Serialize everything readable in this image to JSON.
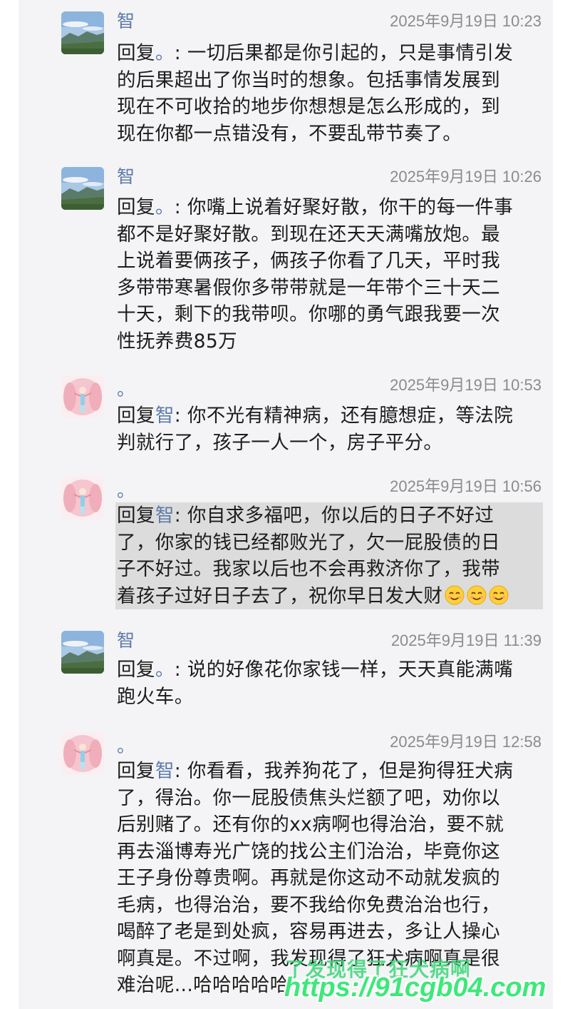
{
  "messages": [
    {
      "sender": "智",
      "time": "2025年9月19日 10:23",
      "reply_prefix": "回复",
      "reply_target": "。",
      "lines": [
        ": 一切后果都是你引起的，只是事情引发",
        "的后果超出了你当时的想象。包括事情发展到",
        "现在不可收拾的地步你想想是怎么形成的，到",
        "现在你都一点错没有，不要乱带节奏了。"
      ]
    },
    {
      "sender": "智",
      "time": "2025年9月19日 10:26",
      "reply_prefix": "回复",
      "reply_target": "。",
      "lines": [
        ": 你嘴上说着好聚好散，你干的每一件事",
        "都不是好聚好散。到现在还天天满嘴放炮。最",
        "上说着要俩孩子，俩孩子你看了几天，平时我",
        "多带带寒暑假你多带带就是一年带个三十天二",
        "十天，剩下的我带呗。你哪的勇气跟我要一次",
        "性抚养费85万"
      ]
    },
    {
      "sender": "。",
      "time": "2025年9月19日 10:53",
      "reply_prefix": "回复",
      "reply_target": "智",
      "lines": [
        ": 你不光有精神病，还有臆想症，等法院",
        "判就行了，孩子一人一个，房子平分。"
      ]
    },
    {
      "sender": "。",
      "time": "2025年9月19日 10:56",
      "reply_prefix": "回复",
      "reply_target": "智",
      "lines": [
        ": 你自求多福吧，你以后的日子不好过",
        "了，你家的钱已经都败光了，欠一屁股债的日",
        "子不好过。我家以后也不会再救济你了，我带",
        "着孩子过好日子去了，祝你早日发大财"
      ],
      "emoji_count": 3
    },
    {
      "sender": "智",
      "time": "2025年9月19日 11:39",
      "reply_prefix": "回复",
      "reply_target": "。",
      "lines": [
        ": 说的好像花你家钱一样，天天真能满嘴",
        "跑火车。"
      ]
    },
    {
      "sender": "。",
      "time": "2025年9月19日 12:58",
      "reply_prefix": "回复",
      "reply_target": "智",
      "lines": [
        ": 你看看，我养狗花了，但是狗得狂犬病",
        "了，得治。你一屁股债焦头烂额了吧，劝你以",
        "后别赌了。还有你的xx病啊也得治治，要不就",
        "再去淄博寿光广饶的找公主们治治，毕竟你这",
        "王子身份尊贵啊。再就是你这动不动就发疯的",
        "毛病，也得治治，要不我给你免费治治也行，",
        "喝醉了老是到处疯，容易再进去，多让人操心",
        "啊真是。不过啊，我发现得了狂犬病啊真是很",
        "难治呢...哈哈哈哈哈"
      ]
    }
  ],
  "watermark": {
    "line1": "了发现得了狂犬病啊",
    "url": "https://91cgb04.com"
  },
  "colors": {
    "name_blue": "#5d7aa8",
    "time_gray": "#8b8b8b",
    "watermark_green": "#3ee87a",
    "highlight": "#dcdcdc"
  }
}
